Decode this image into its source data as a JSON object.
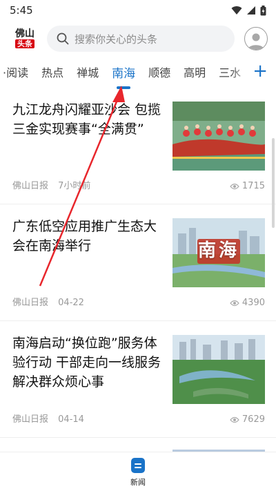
{
  "status": {
    "time": "5:45"
  },
  "header": {
    "logo_line1": "佛山",
    "logo_line2": "头条",
    "search_placeholder": "搜索你关心的头条"
  },
  "tabs": [
    {
      "label": "·阅读",
      "active": false
    },
    {
      "label": "热点",
      "active": false
    },
    {
      "label": "禅城",
      "active": false
    },
    {
      "label": "南海",
      "active": true
    },
    {
      "label": "顺德",
      "active": false
    },
    {
      "label": "高明",
      "active": false
    },
    {
      "label": "三水",
      "active": false
    }
  ],
  "tab_add": "+",
  "articles": [
    {
      "title": "九江龙舟闪耀亚沙会 包揽三金实现赛事“全满贯”",
      "source": "佛山日报",
      "time": "7小时前",
      "views": "1715",
      "image": "dragon-boat-race-photo"
    },
    {
      "title": "广东低空应用推广生态大会在南海举行",
      "source": "佛山日报",
      "time": "04-22",
      "views": "4390",
      "image": "nanhai-aerial-city-photo",
      "image_text": "南海"
    },
    {
      "title": "南海启动“换位跑”服务体验行动 干部走向一线服务解决群众烦心事",
      "source": "佛山日报",
      "time": "04-14",
      "views": "7629",
      "image": "nanhai-park-aerial-photo"
    }
  ],
  "bottom_nav": {
    "label": "新闻"
  },
  "colors": {
    "accent": "#1a73c8",
    "annotation_arrow": "#e8262c",
    "logo_red": "#d7000f"
  }
}
